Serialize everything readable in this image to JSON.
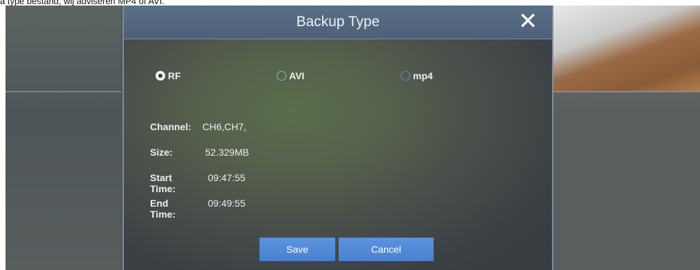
{
  "caption": "a type bestand, wij adviseren MP4 of AVI.",
  "dialog": {
    "title": "Backup Type",
    "close_icon": "close-icon",
    "options": [
      {
        "label": "RF",
        "checked": true
      },
      {
        "label": "AVI",
        "checked": false
      },
      {
        "label": "mp4",
        "checked": false
      }
    ],
    "info": {
      "channel_label": "Channel:",
      "channel_value": "CH6,CH7,",
      "size_label": "Size:",
      "size_value": "52.329MB",
      "start_label": "Start Time:",
      "start_value": "09:47:55",
      "end_label": "End Time:",
      "end_value": "09:49:55"
    },
    "buttons": {
      "save": "Save",
      "cancel": "Cancel"
    }
  },
  "colors": {
    "title_bar": "#4c6078",
    "button": "#4a82d0",
    "radio_accent": "#4d8fe6"
  }
}
